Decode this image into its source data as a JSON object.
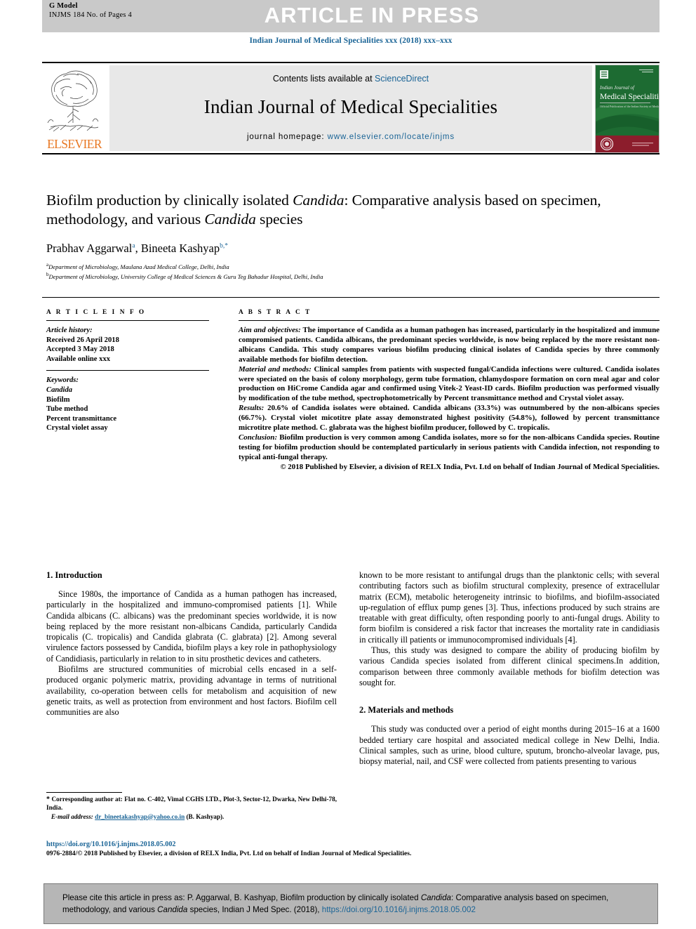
{
  "header": {
    "gmodel_label": "G Model",
    "gmodel_ref": "INJMS 184 No. of Pages 4",
    "article_in_press": "ARTICLE IN PRESS",
    "journal_citation": "Indian Journal of Medical Specialities xxx (2018) xxx–xxx"
  },
  "masthead": {
    "publisher_name": "ELSEVIER",
    "contents_prefix": "Contents lists available at ",
    "contents_link": "ScienceDirect",
    "journal_title": "Indian Journal of Medical Specialities",
    "homepage_prefix": "journal homepage: ",
    "homepage_url": "www.elsevier.com/locate/injms",
    "cover_line1": "Indian Journal of",
    "cover_line2": "Medical Specialities"
  },
  "article": {
    "title_part1": "Biofilm production by clinically isolated ",
    "title_italic1": "Candida",
    "title_part2": ": Comparative analysis based on specimen, methodology, and various ",
    "title_italic2": "Candida",
    "title_part3": " species",
    "authors": "Prabhav Aggarwal, Bineeta Kashyap",
    "author1": "Prabhav Aggarwal",
    "author1_sup": "a",
    "author2": "Bineeta Kashyap",
    "author2_sup": "b,*",
    "affiliation_a_sup": "a",
    "affiliation_a": "Department of Microbiology, Maulana Azad Medical College, Delhi, India",
    "affiliation_b_sup": "b",
    "affiliation_b": "Department of Microbiology, University College of Medical Sciences & Guru Teg Bahadur Hospital, Delhi, India"
  },
  "article_info": {
    "heading": "A R T I C L E  I N F O",
    "history_label": "Article history:",
    "received": "Received 26 April 2018",
    "accepted": "Accepted 3 May 2018",
    "available": "Available online xxx",
    "keywords_label": "Keywords:",
    "keywords": [
      "Candida",
      "Biofilm",
      "Tube method",
      "Percent transmittance",
      "Crystal violet assay"
    ]
  },
  "abstract": {
    "heading": "A B S T R A C T",
    "aim_label": "Aim and objectives:",
    "aim_text": " The importance of Candida as a human pathogen has increased, particularly in the hospitalized and immune compromised patients. Candida albicans, the predominant species worldwide, is now being replaced by the more resistant non-albicans Candida. This study compares various biofilm producing clinical isolates of Candida species by three commonly available methods for biofilm detection.",
    "methods_label": "Material and methods:",
    "methods_text": " Clinical samples from patients with suspected fungal/Candida infections were cultured. Candida isolates were speciated on the basis of colony morphology, germ tube formation, chlamydospore formation on corn meal agar and color production on HiCrome Candida agar and confirmed using Vitek-2 Yeast-ID cards. Biofilm production was performed visually by modification of the tube method, spectrophotometrically by Percent transmittance method and Crystal violet assay.",
    "results_label": "Results:",
    "results_text": " 20.6% of Candida isolates were obtained. Candida albicans (33.3%) was outnumbered by the non-albicans species (66.7%). Crystal violet micotitre plate assay demonstrated highest positivity (54.8%), followed by percent transmittance microtitre plate method. C. glabrata was the highest biofilm producer, followed by C. tropicalis.",
    "conclusion_label": "Conclusion:",
    "conclusion_text": " Biofilm production is very common among Candida isolates, more so for the non-albicans Candida species. Routine testing for biofilm production should be contemplated particularly in serious patients with Candida infection, not responding to typical anti-fungal therapy.",
    "copyright": "© 2018 Published by Elsevier, a division of RELX India, Pvt. Ltd on behalf of Indian Journal of Medical Specialities."
  },
  "sections": {
    "intro_heading": "1. Introduction",
    "methods_heading": "2. Materials and methods",
    "intro_p1": "Since 1980s, the importance of Candida as a human pathogen has increased, particularly in the hospitalized and immuno-compromised patients [1]. While Candida albicans (C. albicans) was the predominant species worldwide, it is now being replaced by the more resistant non-albicans Candida, particularly Candida tropicalis (C. tropicalis) and Candida glabrata (C. glabrata) [2]. Among several virulence factors possessed by Candida, biofilm plays a key role in pathophysiology of Candidiasis, particularly in relation to in situ prosthetic devices and catheters.",
    "intro_p2": "Biofilms are structured communities of microbial cells encased in a self-produced organic polymeric matrix, providing advantage in terms of nutritional availability, co-operation between cells for metabolism and acquisition of new genetic traits, as well as protection from environment and host factors. Biofilm cell communities are also",
    "intro_p3": "known to be more resistant to antifungal drugs than the planktonic cells; with several contributing factors such as biofilm structural complexity, presence of extracellular matrix (ECM), metabolic heterogeneity intrinsic to biofilms, and biofilm-associated up-regulation of efflux pump genes [3]. Thus, infections produced by such strains are treatable with great difficulty, often responding poorly to anti-fungal drugs. Ability to form biofilm is considered a risk factor that increases the mortality rate in candidiasis in critically ill patients or immunocompromised individuals [4].",
    "intro_p4": "Thus, this study was designed to compare the ability of producing biofilm by various Candida species isolated from different clinical specimens.In addition, comparison between three commonly available methods for biofilm detection was sought for.",
    "methods_p1": "This study was conducted over a period of eight months during 2015–16 at a 1600 bedded tertiary care hospital and associated medical college in New Delhi, India. Clinical samples, such as urine, blood culture, sputum, broncho-alveolar lavage, pus, biopsy material, nail, and CSF were collected from patients presenting to various"
  },
  "footnote": {
    "star": "*",
    "corresponding": " Corresponding author at: Flat no. C-402, Vimal CGHS LTD., Plot-3, Sector-12, Dwarka, New Delhi-78, India.",
    "email_label": "E-mail address:",
    "email": "dr_bineetakashyap@yahoo.co.in",
    "email_suffix": " (B. Kashyap).",
    "doi": "https://doi.org/10.1016/j.injms.2018.05.002",
    "issn_copyright": "0976-2884/© 2018 Published by Elsevier, a division of RELX India, Pvt. Ltd on behalf of Indian Journal of Medical Specialities."
  },
  "cite_box": {
    "prefix": "Please cite this article in press as: P. Aggarwal, B. Kashyap, Biofilm production by clinically isolated ",
    "italic1": "Candida",
    "middle": ": Comparative analysis based on specimen, methodology, and various ",
    "italic2": "Candida",
    "suffix": " species, Indian J Med Spec. (2018), ",
    "link": "https://doi.org/10.1016/j.injms.2018.05.002"
  },
  "colors": {
    "link_blue": "#1a6496",
    "elsevier_orange": "#e87722",
    "banner_grey": "#c9c9c9",
    "box_grey": "#e8e8e8",
    "cite_grey": "#b6b6b6",
    "cover_green": "#1d6b32",
    "cover_maroon": "#8c1d2c"
  }
}
